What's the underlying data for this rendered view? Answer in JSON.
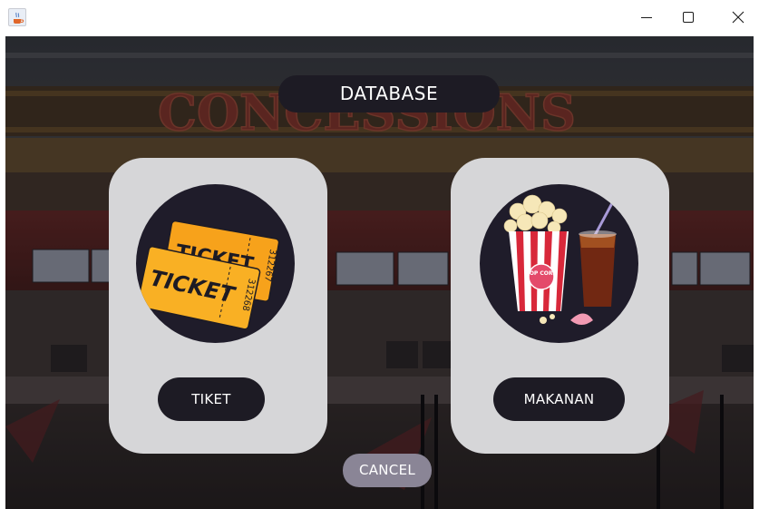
{
  "window": {
    "icon": "java-cup-icon",
    "controls": {
      "minimize": "minimize-icon",
      "maximize": "maximize-icon",
      "close": "close-icon"
    }
  },
  "background": {
    "sign_text": "CONCESSIONS"
  },
  "header": {
    "title": "DATABASE"
  },
  "cards": [
    {
      "image": "ticket-illustration",
      "ticket_text": "TICKET",
      "serial_a": "312267",
      "serial_b": "312268",
      "button_label": "TIKET"
    },
    {
      "image": "popcorn-soda-illustration",
      "popcorn_text": "POP CORN",
      "button_label": "MAKANAN"
    }
  ],
  "footer": {
    "cancel_label": "CANCEL"
  },
  "colors": {
    "dark": "#1d1b24",
    "card": "#d6d6d8",
    "cancel": "#8a8596",
    "ticket": "#f7a21b"
  }
}
